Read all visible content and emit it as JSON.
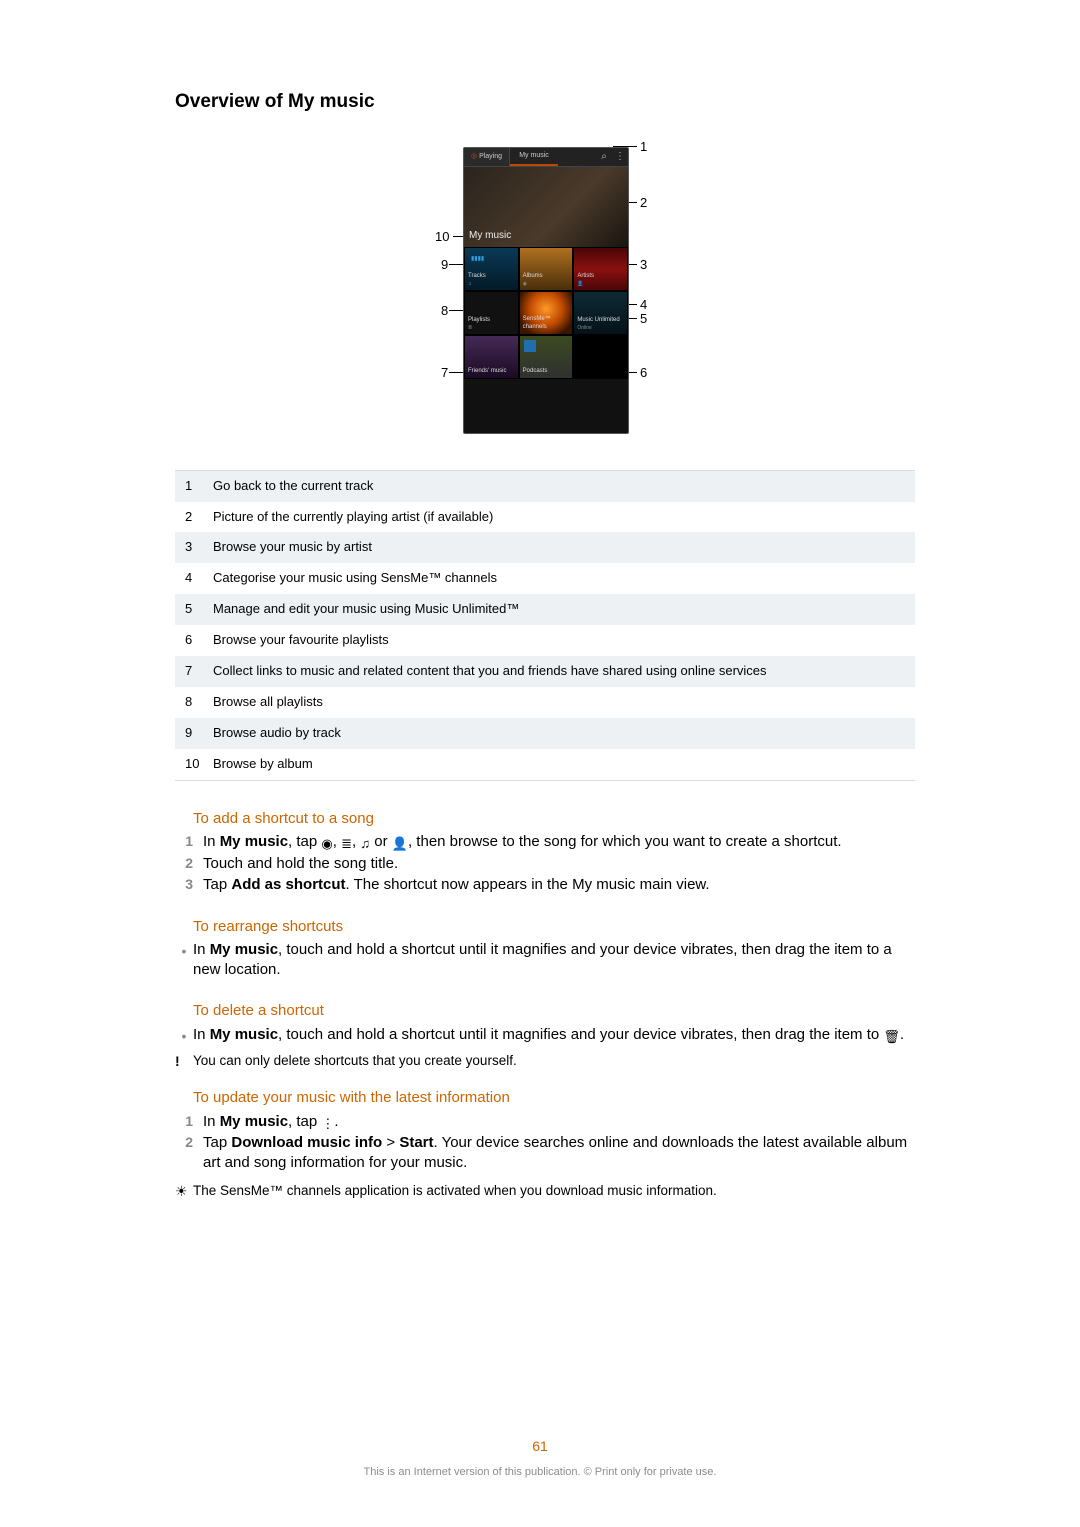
{
  "title": "Overview of My music",
  "phone": {
    "tab_playing": "Playing",
    "tab_mymusic": "My music",
    "hero_label": "My music",
    "tiles": {
      "tracks": "Tracks",
      "albums": "Albums",
      "artists": "Artists",
      "playlists": "Playlists",
      "sensme": "SensMe™ channels",
      "music_unlimited": "Music Unlimited",
      "friends": "Friends' music",
      "podcasts": "Podcasts"
    }
  },
  "callouts": [
    "1",
    "2",
    "3",
    "4",
    "5",
    "6",
    "7",
    "8",
    "9",
    "10"
  ],
  "legend": [
    {
      "n": "1",
      "t": "Go back to the current track"
    },
    {
      "n": "2",
      "t": "Picture of the currently playing artist (if available)"
    },
    {
      "n": "3",
      "t": "Browse your music by artist"
    },
    {
      "n": "4",
      "t": "Categorise your music using SensMe™ channels"
    },
    {
      "n": "5",
      "t": "Manage and edit your music using Music Unlimited™"
    },
    {
      "n": "6",
      "t": "Browse your favourite playlists"
    },
    {
      "n": "7",
      "t": "Collect links to music and related content that you and friends have shared using online services"
    },
    {
      "n": "8",
      "t": "Browse all playlists"
    },
    {
      "n": "9",
      "t": "Browse audio by track"
    },
    {
      "n": "10",
      "t": "Browse by album"
    }
  ],
  "sec_add_head": "To add a shortcut to a song",
  "sec_add": {
    "s1_a": "In ",
    "s1_b": "My music",
    "s1_c": ", tap ",
    "s1_d": ", then browse to the song for which you want to create a shortcut.",
    "s2": "Touch and hold the song title.",
    "s3_a": "Tap ",
    "s3_b": "Add as shortcut",
    "s3_c": ". The shortcut now appears in the My music main view."
  },
  "sec_rearr_head": "To rearrange shortcuts",
  "sec_rearr": {
    "a": "In ",
    "b": "My music",
    "c": ", touch and hold a shortcut until it magnifies and your device vibrates, then drag the item to a new location."
  },
  "sec_del_head": "To delete a shortcut",
  "sec_del": {
    "a": "In ",
    "b": "My music",
    "c": ", touch and hold a shortcut until it magnifies and your device vibrates, then drag the item to ",
    "d": "."
  },
  "note_del": "You can only delete shortcuts that you create yourself.",
  "sec_upd_head": "To update your music with the latest information",
  "sec_upd": {
    "s1_a": "In ",
    "s1_b": "My music",
    "s1_c": ", tap ",
    "s1_d": ".",
    "s2_a": "Tap ",
    "s2_b": "Download music info",
    "s2_c": " > ",
    "s2_d": "Start",
    "s2_e": ". Your device searches online and downloads the latest available album art and song information for your music."
  },
  "tip_upd": "The SensMe™ channels application is activated when you download music information.",
  "page_number": "61",
  "footer": "This is an Internet version of this publication. © Print only for private use."
}
